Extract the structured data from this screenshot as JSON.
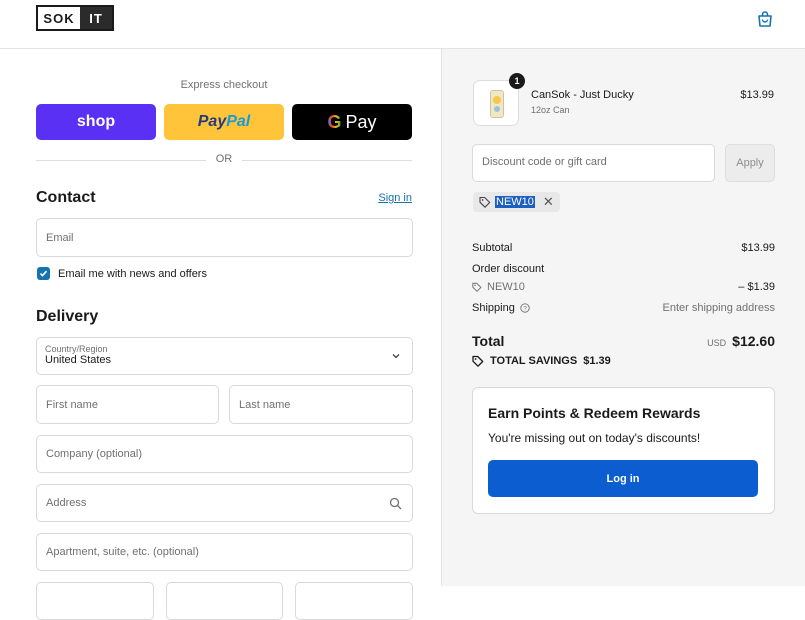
{
  "header": {
    "logo_left": "SOK",
    "logo_right": "IT",
    "cart_icon": "shopping-bag-icon"
  },
  "express": {
    "title": "Express checkout",
    "shop_label": "shop",
    "paypal_part1": "Pay",
    "paypal_part2": "Pal",
    "gpay_g": "G",
    "gpay_label": "Pay",
    "or_label": "OR"
  },
  "contact": {
    "title": "Contact",
    "sign_in": "Sign in",
    "email_placeholder": "Email",
    "news_label": "Email me with news and offers",
    "news_checked": true
  },
  "delivery": {
    "title": "Delivery",
    "country_label": "Country/Region",
    "country_value": "United States",
    "first_name_placeholder": "First name",
    "last_name_placeholder": "Last name",
    "company_placeholder": "Company (optional)",
    "address_placeholder": "Address",
    "apartment_placeholder": "Apartment, suite, etc. (optional)"
  },
  "order": {
    "item": {
      "quantity": "1",
      "name": "CanSok - Just Ducky",
      "variant": "12oz Can",
      "price": "$13.99"
    },
    "discount_placeholder": "Discount code or gift card",
    "apply_label": "Apply",
    "applied_code": "NEW10",
    "subtotal_label": "Subtotal",
    "subtotal_value": "$13.99",
    "order_discount_label": "Order discount",
    "discount_code": "NEW10",
    "discount_value": "– $1.39",
    "shipping_label": "Shipping",
    "shipping_value": "Enter shipping address",
    "total_label": "Total",
    "total_currency": "USD",
    "total_value": "$12.60",
    "savings_label": "TOTAL SAVINGS",
    "savings_value": "$1.39"
  },
  "rewards": {
    "title": "Earn Points & Redeem Rewards",
    "subtitle": "You're missing out on today's discounts!",
    "login_label": "Log in"
  },
  "colors": {
    "accent": "#1773b0",
    "shop": "#5a31f4",
    "paypal": "#ffc439",
    "login": "#0b5dd0"
  }
}
